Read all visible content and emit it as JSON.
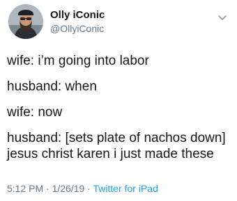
{
  "user": {
    "display_name": "Olly iConic",
    "handle": "@OllyiConic",
    "avatar_icon": "avatar-photo"
  },
  "tweet": {
    "lines": [
      "wife: i’m going into labor",
      "husband: when",
      "wife: now",
      "husband: [sets plate of nachos down]",
      "jesus christ karen i just made these"
    ]
  },
  "meta": {
    "time_date": "5:12 PM · 1/26/19 · ",
    "source": "Twitter for iPad"
  },
  "colors": {
    "text": "#14171a",
    "muted": "#657786",
    "link": "#1da1f2",
    "background": "#ffffff"
  },
  "icons": {
    "menu": "chevron-down-icon"
  }
}
